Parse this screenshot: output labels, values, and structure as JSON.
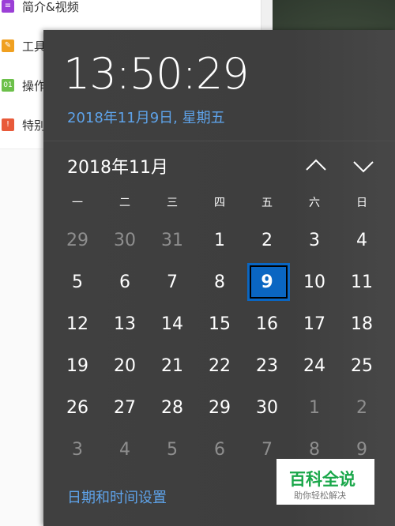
{
  "background_app": {
    "items": [
      {
        "label": "简介&视频",
        "badge": "≡",
        "color": "#9b3fd6"
      },
      {
        "label": "工具",
        "badge": "✎",
        "color": "#f0a020"
      },
      {
        "label": "操作",
        "badge": "01",
        "color": "#6cc04a"
      },
      {
        "label": "特别",
        "badge": "!",
        "color": "#e85a3a"
      }
    ]
  },
  "clock": {
    "time": "13:50:29",
    "date": "2018年11月9日, 星期五"
  },
  "calendar": {
    "month_label": "2018年11月",
    "nav_up_icon": "chevron-up-icon",
    "nav_down_icon": "chevron-down-icon",
    "weekdays": [
      "一",
      "二",
      "三",
      "四",
      "五",
      "六",
      "日"
    ],
    "weeks": [
      [
        "29",
        "30",
        "31",
        "1",
        "2",
        "3",
        "4"
      ],
      [
        "5",
        "6",
        "7",
        "8",
        "9",
        "10",
        "11"
      ],
      [
        "12",
        "13",
        "14",
        "15",
        "16",
        "17",
        "18"
      ],
      [
        "19",
        "20",
        "21",
        "22",
        "23",
        "24",
        "25"
      ],
      [
        "26",
        "27",
        "28",
        "29",
        "30",
        "1",
        "2"
      ],
      [
        "3",
        "4",
        "5",
        "6",
        "7",
        "8",
        "9"
      ]
    ],
    "selected_day": "9",
    "accent_color": "#0a66c2"
  },
  "settings_link": "日期和时间设置",
  "watermark": {
    "main": "百科全说",
    "sub": "助你轻松解决"
  }
}
